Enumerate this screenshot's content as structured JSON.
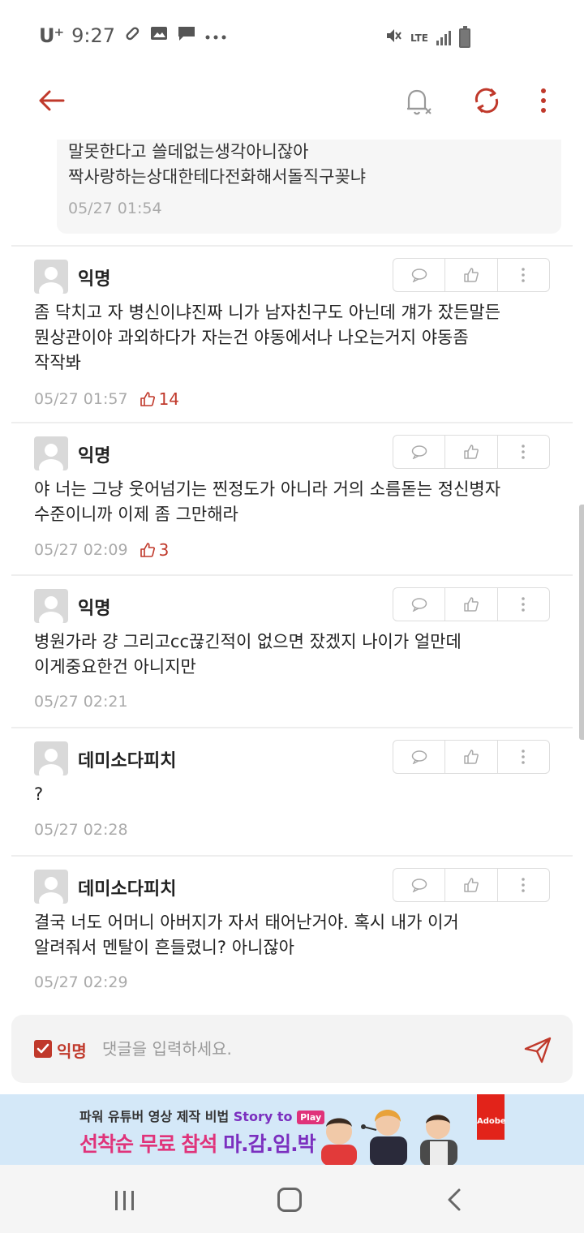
{
  "status_bar": {
    "carrier": "U⁺",
    "time": "9:27",
    "network": "LTE"
  },
  "app_bar": {
    "back_icon": "arrow-left-icon",
    "bell_icon": "bell-off-icon",
    "refresh_icon": "refresh-icon",
    "more_icon": "more-vertical-icon",
    "accent_color": "#c0392b"
  },
  "previous_reply": {
    "lines": [
      "말못한다고 쓸데없는생각아니잖아",
      "짝사랑하는상대한테다전화해서돌직구꽂냐"
    ],
    "date": "05/27 01:54"
  },
  "comments": [
    {
      "author": "익명",
      "lines": [
        "좀 닥치고 자 병신이냐진짜 니가 남자친구도 아닌데 걔가 잤든말든",
        "뭔상관이야 과외하다가 자는건 야동에서나 나오는거지 야동좀",
        "작작봐"
      ],
      "date": "05/27 01:57",
      "likes": "14"
    },
    {
      "author": "익명",
      "lines": [
        "야 너는 그냥 웃어넘기는 찐정도가 아니라 거의 소름돋는 정신병자",
        "수준이니까 이제 좀 그만해라"
      ],
      "date": "05/27 02:09",
      "likes": "3"
    },
    {
      "author": "익명",
      "lines": [
        "병원가라 걍 그리고cc끊긴적이 없으면 잤겠지 나이가 얼만데",
        "이게중요한건 아니지만"
      ],
      "date": "05/27 02:21",
      "likes": ""
    },
    {
      "author": "데미소다피치",
      "lines": [
        "?"
      ],
      "date": "05/27 02:28",
      "likes": ""
    },
    {
      "author": "데미소다피치",
      "lines": [
        "결국 너도 어머니 아버지가 자서 태어난거야. 혹시 내가 이거",
        "알려줘서 멘탈이 흔들렸니? 아니잖아"
      ],
      "date": "05/27 02:29",
      "likes": ""
    }
  ],
  "comment_input": {
    "anonymous_label": "익명",
    "anonymous_checked": true,
    "placeholder": "댓글을 입력하세요.",
    "send_icon": "send-icon"
  },
  "ad": {
    "line1_prefix": "파워 유튜버 영상 제작 비법",
    "line1_story": "Story to",
    "line1_play": "Play",
    "line2_pink": "선착순 무료 참석",
    "line2_purple": "마.감.임.박",
    "brand": "Adobe"
  },
  "nav_bar": {
    "recent_icon": "recent-apps-icon",
    "home_icon": "home-icon",
    "back_icon": "nav-back-icon"
  }
}
